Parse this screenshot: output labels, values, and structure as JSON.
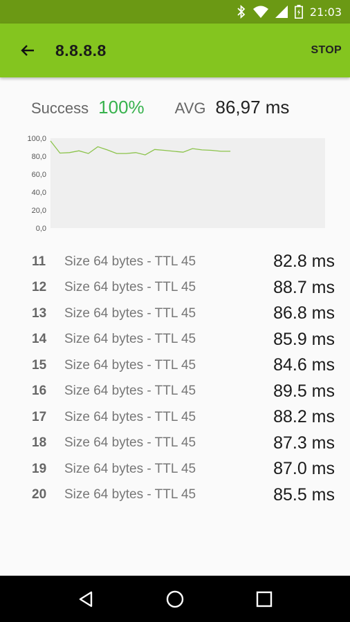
{
  "status_bar": {
    "time": "21:03",
    "icons": [
      "bluetooth-icon",
      "wifi-icon",
      "signal-icon",
      "battery-icon"
    ]
  },
  "app_bar": {
    "title": "8.8.8.8",
    "stop_label": "STOP",
    "color": "#84c51f"
  },
  "summary": {
    "success_label": "Success",
    "success_value": "100%",
    "avg_label": "AVG",
    "avg_value": "86,97 ms"
  },
  "chart_data": {
    "type": "line",
    "y_ticks": [
      "100,0",
      "80,0",
      "60,0",
      "40,0",
      "20,0",
      "0,0"
    ],
    "ylim": [
      0,
      100
    ],
    "x_count": 30,
    "series": [
      {
        "values": [
          97,
          83.5,
          84,
          86,
          83,
          90.5,
          87,
          83,
          83,
          84,
          81.5,
          87.5,
          86.5,
          85.5,
          84.5,
          88.5,
          87,
          86.5,
          85.5,
          85.5
        ]
      }
    ],
    "grid": false,
    "line_color": "#8bc34a"
  },
  "pings": [
    {
      "seq": "11",
      "desc": "Size 64 bytes - TTL 45",
      "time": "82.8 ms"
    },
    {
      "seq": "12",
      "desc": "Size 64 bytes - TTL 45",
      "time": "88.7 ms"
    },
    {
      "seq": "13",
      "desc": "Size 64 bytes - TTL 45",
      "time": "86.8 ms"
    },
    {
      "seq": "14",
      "desc": "Size 64 bytes - TTL 45",
      "time": "85.9 ms"
    },
    {
      "seq": "15",
      "desc": "Size 64 bytes - TTL 45",
      "time": "84.6 ms"
    },
    {
      "seq": "16",
      "desc": "Size 64 bytes - TTL 45",
      "time": "89.5 ms"
    },
    {
      "seq": "17",
      "desc": "Size 64 bytes - TTL 45",
      "time": "88.2 ms"
    },
    {
      "seq": "18",
      "desc": "Size 64 bytes - TTL 45",
      "time": "87.3 ms"
    },
    {
      "seq": "19",
      "desc": "Size 64 bytes - TTL 45",
      "time": "87.0 ms"
    },
    {
      "seq": "20",
      "desc": "Size 64 bytes - TTL 45",
      "time": "85.5 ms"
    }
  ],
  "nav_bar": {
    "buttons": [
      "back-nav-icon",
      "home-nav-icon",
      "recents-nav-icon"
    ]
  }
}
